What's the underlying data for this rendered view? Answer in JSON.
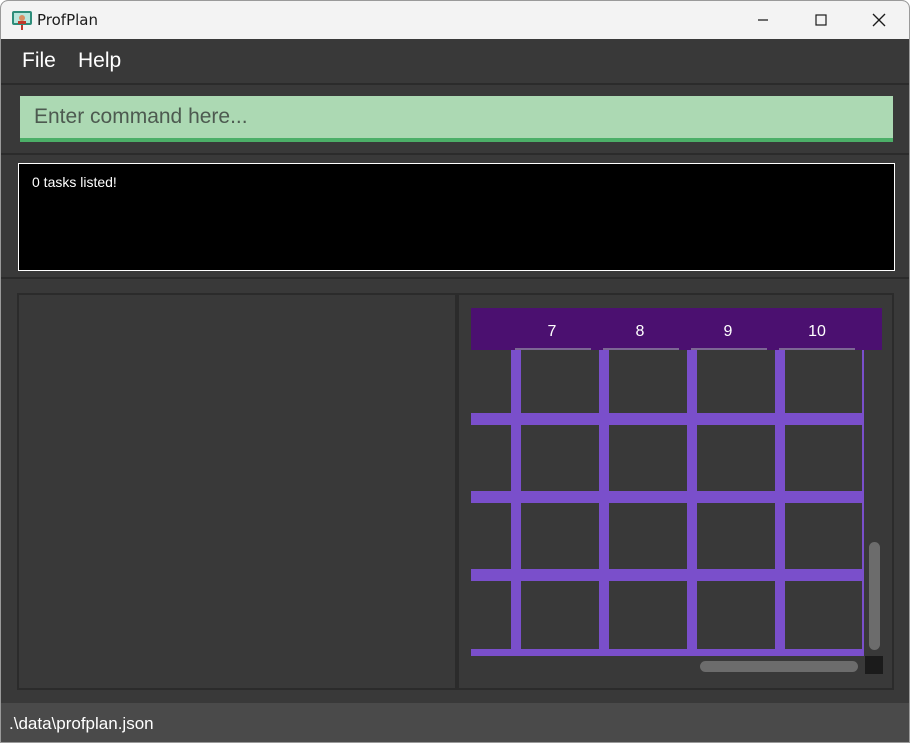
{
  "window": {
    "title": "ProfPlan"
  },
  "menu": {
    "items": [
      "File",
      "Help"
    ]
  },
  "command": {
    "placeholder": "Enter command here..."
  },
  "result": {
    "text": "0 tasks listed!"
  },
  "calendar": {
    "columns": [
      "7",
      "8",
      "9",
      "10"
    ]
  },
  "status": {
    "path": ".\\data\\profplan.json"
  },
  "colors": {
    "command_bg": "#acd9b3",
    "command_underline": "#4caf68",
    "calendar_header": "#4b1070",
    "calendar_grid": "#7a4fcb",
    "panel_bg": "#393939"
  },
  "icons": [
    "app-icon",
    "minimize-icon",
    "maximize-icon",
    "close-icon"
  ]
}
